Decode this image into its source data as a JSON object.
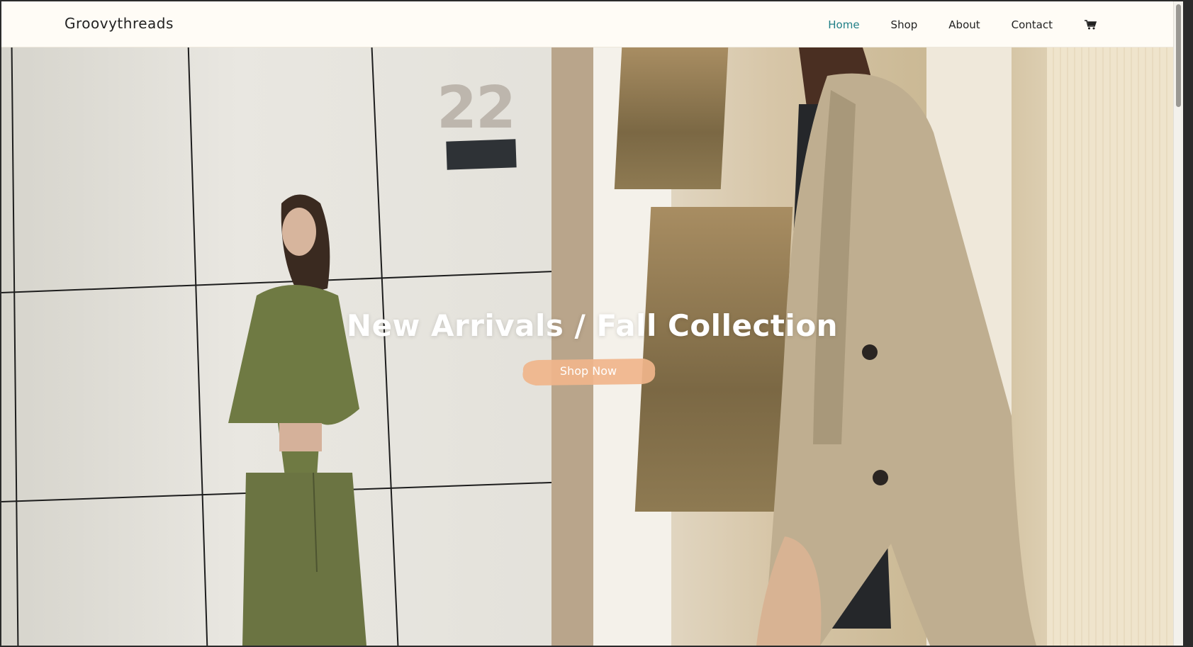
{
  "header": {
    "brand": "Groovythreads",
    "nav": [
      {
        "label": "Home",
        "active": true
      },
      {
        "label": "Shop",
        "active": false
      },
      {
        "label": "About",
        "active": false
      },
      {
        "label": "Contact",
        "active": false
      }
    ],
    "cart_icon": "shopping-cart-icon",
    "active_color": "#1f7f86"
  },
  "hero": {
    "title": "New Arrivals / Fall Collection",
    "cta_label": "Shop Now",
    "cta_color": "#f0b58b",
    "wall_number": "22"
  }
}
